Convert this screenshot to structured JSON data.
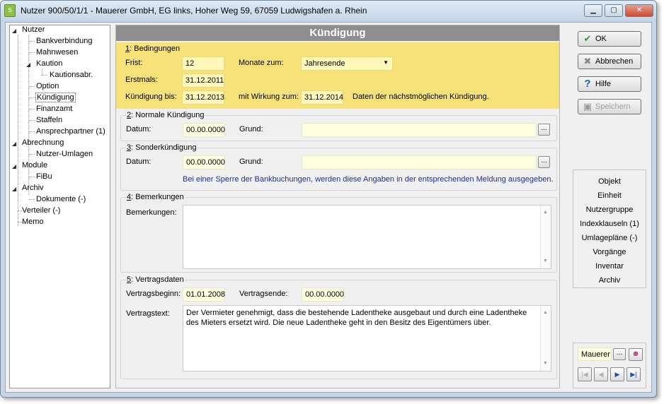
{
  "window": {
    "title": "Nutzer 900/50/1/1 - Mauerer GmbH, EG links, Hoher Weg 59, 67059 Ludwigshafen a. Rhein",
    "app_icon_text": "S",
    "minimize": "▁",
    "maximize": "▢",
    "close": "✕"
  },
  "tree": {
    "nutzer": "Nutzer",
    "bankverbindung": "Bankverbindung",
    "mahnwesen": "Mahnwesen",
    "kaution": "Kaution",
    "kautionsabr": "Kautionsabr.",
    "option": "Option",
    "kuendigung": "Kündigung",
    "finanzamt": "Finanzamt",
    "staffeln": "Staffeln",
    "ansprechpartner": "Ansprechpartner (1)",
    "abrechnung": "Abrechnung",
    "nutzer_umlagen": "Nutzer-Umlagen",
    "module": "Module",
    "fibu": "FiBu",
    "archiv": "Archiv",
    "dokumente": "Dokumente (-)",
    "verteiler": "Verteiler (-)",
    "memo": "Memo"
  },
  "main": {
    "header": "Kündigung",
    "g1": {
      "num": "1",
      "title": ": Bedingungen",
      "frist_label": "Frist:",
      "frist": "12",
      "monate_label": "Monate zum:",
      "monate": "Jahresende",
      "erstmals_label": "Erstmals:",
      "erstmals": "31.12.2011",
      "kuendigung_bis_label": "Kündigung bis:",
      "kuendigung_bis": "31.12.2013",
      "wirkung_label": "mit Wirkung zum:",
      "wirkung": "31.12.2014",
      "hint": "Daten der nächstmöglichen Kündigung."
    },
    "g2": {
      "num": "2",
      "title": ": Normale Kündigung",
      "datum_label": "Datum:",
      "datum": "00.00.0000",
      "grund_label": "Grund:",
      "grund": ""
    },
    "g3": {
      "num": "3",
      "title": ": Sonderkündigung",
      "datum_label": "Datum:",
      "datum": "00.00.0000",
      "grund_label": "Grund:",
      "grund": "",
      "info": "Bei einer Sperre der Bankbuchungen, werden diese Angaben in der entsprechenden Meldung ausgegeben."
    },
    "g4": {
      "num": "4",
      "title": ": Bemerkungen",
      "label": "Bemerkungen:",
      "text": ""
    },
    "g5": {
      "num": "5",
      "title": ": Vertragsdaten",
      "beginn_label": "Vertragsbeginn:",
      "beginn": "01.01.2008",
      "ende_label": "Vertragsende:",
      "ende": "00.00.0000",
      "text_label": "Vertragstext:",
      "text": "Der Vermieter genehmigt, dass die bestehende Ladentheke ausgebaut und durch eine Ladentheke des Mieters ersetzt wird. Die neue Ladentheke geht in den Besitz des Eigentümers über."
    },
    "ellipsis": "..."
  },
  "buttons": {
    "ok": "OK",
    "abbrechen": "Abbrechen",
    "hilfe": "Hilfe",
    "speichern": "Speichern"
  },
  "nav": [
    "Objekt",
    "Einheit",
    "Nutzergruppe",
    "Indexklauseln (1)",
    "Umlagepläne (-)",
    "Vorgänge",
    "Inventar",
    "Archiv"
  ],
  "pager": {
    "name": "Mauerer",
    "ellipsis": "...",
    "first": "|◀",
    "prev": "◀",
    "next": "▶",
    "last": "▶|"
  },
  "colors": {
    "highlight": "#f7e27a",
    "field": "#ffffe1",
    "header": "#8e8e8e"
  }
}
